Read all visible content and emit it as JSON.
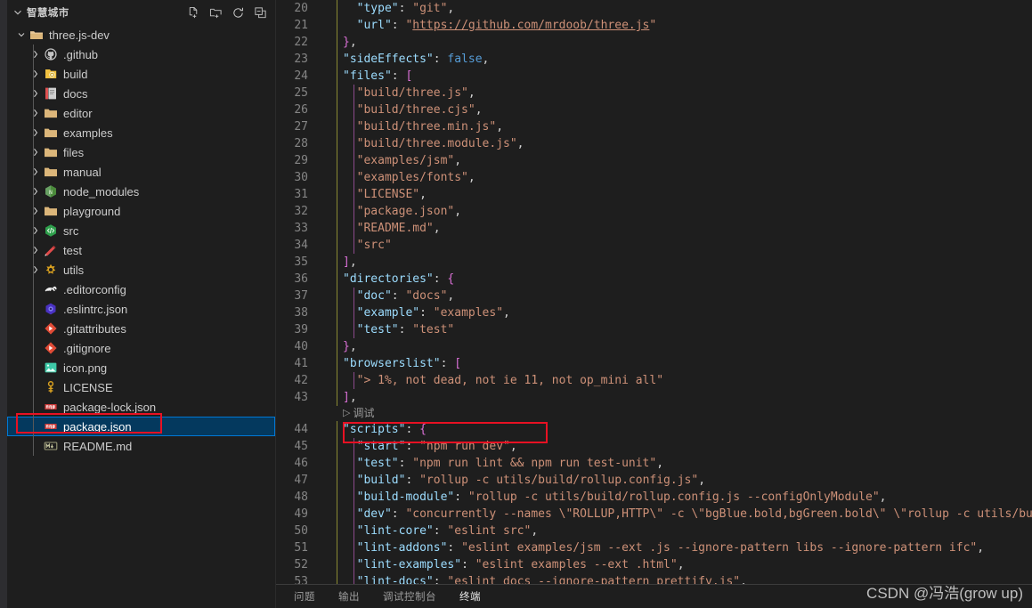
{
  "explorer": {
    "title": "智慧城市",
    "actions": [
      {
        "name": "new-file-icon",
        "tooltip": "新建文件"
      },
      {
        "name": "new-folder-icon",
        "tooltip": "新建文件夹"
      },
      {
        "name": "refresh-icon",
        "tooltip": "刷新资源管理器"
      },
      {
        "name": "collapse-all-icon",
        "tooltip": "在资源管理器中折叠文件夹"
      }
    ],
    "root": {
      "label": "three.js-dev",
      "expanded": true,
      "icon": "folder-open"
    },
    "items": [
      {
        "label": ".github",
        "type": "folder",
        "icon": "github",
        "expanded": false,
        "depth": 2
      },
      {
        "label": "build",
        "type": "folder",
        "icon": "build",
        "expanded": false,
        "depth": 2
      },
      {
        "label": "docs",
        "type": "folder",
        "icon": "docs",
        "expanded": false,
        "depth": 2
      },
      {
        "label": "editor",
        "type": "folder",
        "icon": "folder",
        "expanded": false,
        "depth": 2
      },
      {
        "label": "examples",
        "type": "folder",
        "icon": "folder",
        "expanded": false,
        "depth": 2
      },
      {
        "label": "files",
        "type": "folder",
        "icon": "folder",
        "expanded": false,
        "depth": 2
      },
      {
        "label": "manual",
        "type": "folder",
        "icon": "folder",
        "expanded": false,
        "depth": 2
      },
      {
        "label": "node_modules",
        "type": "folder",
        "icon": "node",
        "expanded": false,
        "depth": 2
      },
      {
        "label": "playground",
        "type": "folder",
        "icon": "folder",
        "expanded": false,
        "depth": 2
      },
      {
        "label": "src",
        "type": "folder",
        "icon": "src",
        "expanded": false,
        "depth": 2
      },
      {
        "label": "test",
        "type": "folder",
        "icon": "test",
        "expanded": false,
        "depth": 2
      },
      {
        "label": "utils",
        "type": "folder",
        "icon": "utils",
        "expanded": false,
        "depth": 2
      },
      {
        "label": ".editorconfig",
        "type": "file",
        "icon": "editorconfig",
        "depth": 2
      },
      {
        "label": ".eslintrc.json",
        "type": "file",
        "icon": "eslint",
        "depth": 2
      },
      {
        "label": ".gitattributes",
        "type": "file",
        "icon": "git",
        "depth": 2
      },
      {
        "label": ".gitignore",
        "type": "file",
        "icon": "git",
        "depth": 2
      },
      {
        "label": "icon.png",
        "type": "file",
        "icon": "image",
        "depth": 2
      },
      {
        "label": "LICENSE",
        "type": "file",
        "icon": "license",
        "depth": 2
      },
      {
        "label": "package-lock.json",
        "type": "file",
        "icon": "npm",
        "depth": 2
      },
      {
        "label": "package.json",
        "type": "file",
        "icon": "npm",
        "depth": 2,
        "selected": true,
        "highlighted": true
      },
      {
        "label": "README.md",
        "type": "file",
        "icon": "markdown",
        "depth": 2
      }
    ]
  },
  "editor": {
    "first_line_number": 20,
    "lines": [
      {
        "num": 20,
        "clipped": true,
        "tokens": [
          {
            "t": "  ",
            "c": "t-punc"
          },
          {
            "t": "\"type\"",
            "c": "t-key"
          },
          {
            "t": ": ",
            "c": "t-punc"
          },
          {
            "t": "\"git\"",
            "c": "t-str"
          },
          {
            "t": ",",
            "c": "t-punc"
          }
        ]
      },
      {
        "num": 21,
        "tokens": [
          {
            "t": "  ",
            "c": "t-punc"
          },
          {
            "t": "\"url\"",
            "c": "t-key"
          },
          {
            "t": ": ",
            "c": "t-punc"
          },
          {
            "t": "\"",
            "c": "t-str"
          },
          {
            "t": "https://github.com/mrdoob/three.js",
            "c": "t-link"
          },
          {
            "t": "\"",
            "c": "t-str"
          }
        ]
      },
      {
        "num": 22,
        "tokens": [
          {
            "t": "}",
            "c": "t-brace1"
          },
          {
            "t": ",",
            "c": "t-punc"
          }
        ]
      },
      {
        "num": 23,
        "tokens": [
          {
            "t": "\"sideEffects\"",
            "c": "t-key"
          },
          {
            "t": ": ",
            "c": "t-punc"
          },
          {
            "t": "false",
            "c": "t-bool"
          },
          {
            "t": ",",
            "c": "t-punc"
          }
        ]
      },
      {
        "num": 24,
        "tokens": [
          {
            "t": "\"files\"",
            "c": "t-key"
          },
          {
            "t": ": ",
            "c": "t-punc"
          },
          {
            "t": "[",
            "c": "t-brace1"
          }
        ]
      },
      {
        "num": 25,
        "tokens": [
          {
            "t": "  ",
            "c": "t-punc"
          },
          {
            "t": "\"build/three.js\"",
            "c": "t-str"
          },
          {
            "t": ",",
            "c": "t-punc"
          }
        ]
      },
      {
        "num": 26,
        "tokens": [
          {
            "t": "  ",
            "c": "t-punc"
          },
          {
            "t": "\"build/three.cjs\"",
            "c": "t-str"
          },
          {
            "t": ",",
            "c": "t-punc"
          }
        ]
      },
      {
        "num": 27,
        "tokens": [
          {
            "t": "  ",
            "c": "t-punc"
          },
          {
            "t": "\"build/three.min.js\"",
            "c": "t-str"
          },
          {
            "t": ",",
            "c": "t-punc"
          }
        ]
      },
      {
        "num": 28,
        "tokens": [
          {
            "t": "  ",
            "c": "t-punc"
          },
          {
            "t": "\"build/three.module.js\"",
            "c": "t-str"
          },
          {
            "t": ",",
            "c": "t-punc"
          }
        ]
      },
      {
        "num": 29,
        "tokens": [
          {
            "t": "  ",
            "c": "t-punc"
          },
          {
            "t": "\"examples/jsm\"",
            "c": "t-str"
          },
          {
            "t": ",",
            "c": "t-punc"
          }
        ]
      },
      {
        "num": 30,
        "tokens": [
          {
            "t": "  ",
            "c": "t-punc"
          },
          {
            "t": "\"examples/fonts\"",
            "c": "t-str"
          },
          {
            "t": ",",
            "c": "t-punc"
          }
        ]
      },
      {
        "num": 31,
        "tokens": [
          {
            "t": "  ",
            "c": "t-punc"
          },
          {
            "t": "\"LICENSE\"",
            "c": "t-str"
          },
          {
            "t": ",",
            "c": "t-punc"
          }
        ]
      },
      {
        "num": 32,
        "tokens": [
          {
            "t": "  ",
            "c": "t-punc"
          },
          {
            "t": "\"package.json\"",
            "c": "t-str"
          },
          {
            "t": ",",
            "c": "t-punc"
          }
        ]
      },
      {
        "num": 33,
        "tokens": [
          {
            "t": "  ",
            "c": "t-punc"
          },
          {
            "t": "\"README.md\"",
            "c": "t-str"
          },
          {
            "t": ",",
            "c": "t-punc"
          }
        ]
      },
      {
        "num": 34,
        "tokens": [
          {
            "t": "  ",
            "c": "t-punc"
          },
          {
            "t": "\"src\"",
            "c": "t-str"
          }
        ]
      },
      {
        "num": 35,
        "tokens": [
          {
            "t": "]",
            "c": "t-brace1"
          },
          {
            "t": ",",
            "c": "t-punc"
          }
        ]
      },
      {
        "num": 36,
        "tokens": [
          {
            "t": "\"directories\"",
            "c": "t-key"
          },
          {
            "t": ": ",
            "c": "t-punc"
          },
          {
            "t": "{",
            "c": "t-brace1"
          }
        ]
      },
      {
        "num": 37,
        "tokens": [
          {
            "t": "  ",
            "c": "t-punc"
          },
          {
            "t": "\"doc\"",
            "c": "t-key"
          },
          {
            "t": ": ",
            "c": "t-punc"
          },
          {
            "t": "\"docs\"",
            "c": "t-str"
          },
          {
            "t": ",",
            "c": "t-punc"
          }
        ]
      },
      {
        "num": 38,
        "tokens": [
          {
            "t": "  ",
            "c": "t-punc"
          },
          {
            "t": "\"example\"",
            "c": "t-key"
          },
          {
            "t": ": ",
            "c": "t-punc"
          },
          {
            "t": "\"examples\"",
            "c": "t-str"
          },
          {
            "t": ",",
            "c": "t-punc"
          }
        ]
      },
      {
        "num": 39,
        "tokens": [
          {
            "t": "  ",
            "c": "t-punc"
          },
          {
            "t": "\"test\"",
            "c": "t-key"
          },
          {
            "t": ": ",
            "c": "t-punc"
          },
          {
            "t": "\"test\"",
            "c": "t-str"
          }
        ]
      },
      {
        "num": 40,
        "tokens": [
          {
            "t": "}",
            "c": "t-brace1"
          },
          {
            "t": ",",
            "c": "t-punc"
          }
        ]
      },
      {
        "num": 41,
        "tokens": [
          {
            "t": "\"browserslist\"",
            "c": "t-key"
          },
          {
            "t": ": ",
            "c": "t-punc"
          },
          {
            "t": "[",
            "c": "t-brace1"
          }
        ]
      },
      {
        "num": 42,
        "tokens": [
          {
            "t": "  ",
            "c": "t-punc"
          },
          {
            "t": "\"> 1%, not dead, not ie 11, not op_mini all\"",
            "c": "t-str"
          }
        ]
      },
      {
        "num": 43,
        "tokens": [
          {
            "t": "]",
            "c": "t-brace1"
          },
          {
            "t": ",",
            "c": "t-punc"
          }
        ]
      },
      {
        "num": 44,
        "tokens": [
          {
            "t": "\"scripts\"",
            "c": "t-key"
          },
          {
            "t": ": ",
            "c": "t-punc"
          },
          {
            "t": "{",
            "c": "t-brace1"
          }
        ]
      },
      {
        "num": 45,
        "tokens": [
          {
            "t": "  ",
            "c": "t-punc"
          },
          {
            "t": "\"start\"",
            "c": "t-key"
          },
          {
            "t": ": ",
            "c": "t-punc"
          },
          {
            "t": "\"npm run dev\"",
            "c": "t-str"
          },
          {
            "t": ",",
            "c": "t-punc"
          }
        ]
      },
      {
        "num": 46,
        "tokens": [
          {
            "t": "  ",
            "c": "t-punc"
          },
          {
            "t": "\"test\"",
            "c": "t-key"
          },
          {
            "t": ": ",
            "c": "t-punc"
          },
          {
            "t": "\"npm run lint && npm run test-unit\"",
            "c": "t-str"
          },
          {
            "t": ",",
            "c": "t-punc"
          }
        ]
      },
      {
        "num": 47,
        "tokens": [
          {
            "t": "  ",
            "c": "t-punc"
          },
          {
            "t": "\"build\"",
            "c": "t-key"
          },
          {
            "t": ": ",
            "c": "t-punc"
          },
          {
            "t": "\"rollup -c utils/build/rollup.config.js\"",
            "c": "t-str"
          },
          {
            "t": ",",
            "c": "t-punc"
          }
        ]
      },
      {
        "num": 48,
        "tokens": [
          {
            "t": "  ",
            "c": "t-punc"
          },
          {
            "t": "\"build-module\"",
            "c": "t-key"
          },
          {
            "t": ": ",
            "c": "t-punc"
          },
          {
            "t": "\"rollup -c utils/build/rollup.config.js --configOnlyModule\"",
            "c": "t-str"
          },
          {
            "t": ",",
            "c": "t-punc"
          }
        ]
      },
      {
        "num": 49,
        "tokens": [
          {
            "t": "  ",
            "c": "t-punc"
          },
          {
            "t": "\"dev\"",
            "c": "t-key"
          },
          {
            "t": ": ",
            "c": "t-punc"
          },
          {
            "t": "\"concurrently --names \\\"ROLLUP,HTTP\\\" -c \\\"bgBlue.bold,bgGreen.bold\\\" \\\"rollup -c utils/buil",
            "c": "t-str"
          }
        ]
      },
      {
        "num": 50,
        "tokens": [
          {
            "t": "  ",
            "c": "t-punc"
          },
          {
            "t": "\"lint-core\"",
            "c": "t-key"
          },
          {
            "t": ": ",
            "c": "t-punc"
          },
          {
            "t": "\"eslint src\"",
            "c": "t-str"
          },
          {
            "t": ",",
            "c": "t-punc"
          }
        ]
      },
      {
        "num": 51,
        "tokens": [
          {
            "t": "  ",
            "c": "t-punc"
          },
          {
            "t": "\"lint-addons\"",
            "c": "t-key"
          },
          {
            "t": ": ",
            "c": "t-punc"
          },
          {
            "t": "\"eslint examples/jsm --ext .js --ignore-pattern libs --ignore-pattern ifc\"",
            "c": "t-str"
          },
          {
            "t": ",",
            "c": "t-punc"
          }
        ]
      },
      {
        "num": 52,
        "tokens": [
          {
            "t": "  ",
            "c": "t-punc"
          },
          {
            "t": "\"lint-examples\"",
            "c": "t-key"
          },
          {
            "t": ": ",
            "c": "t-punc"
          },
          {
            "t": "\"eslint examples --ext .html\"",
            "c": "t-str"
          },
          {
            "t": ",",
            "c": "t-punc"
          }
        ]
      },
      {
        "num": 53,
        "tokens": [
          {
            "t": "  ",
            "c": "t-punc"
          },
          {
            "t": "\"lint-docs\"",
            "c": "t-key"
          },
          {
            "t": ": ",
            "c": "t-punc"
          },
          {
            "t": "\"eslint docs --ignore-pattern prettify.js\"",
            "c": "t-str"
          },
          {
            "t": ",",
            "c": "t-punc"
          }
        ]
      }
    ],
    "codelens": {
      "after_line": 43,
      "label": "调试",
      "icon": "play-icon"
    }
  },
  "panel": {
    "tabs": [
      {
        "label": "问题",
        "active": false
      },
      {
        "label": "输出",
        "active": false
      },
      {
        "label": "调试控制台",
        "active": false
      },
      {
        "label": "终端",
        "active": true
      }
    ]
  },
  "watermark": "CSDN @冯浩(grow up)",
  "colors": {
    "background": "#1e1e1e",
    "activity_strip": "#2d2d30",
    "selection": "#04395e",
    "selection_border": "#0078d4",
    "annotation_red": "#e81123",
    "json_key": "#9cdcfe",
    "json_string": "#ce9178",
    "json_bool": "#569cd6",
    "line_number": "#858585"
  }
}
